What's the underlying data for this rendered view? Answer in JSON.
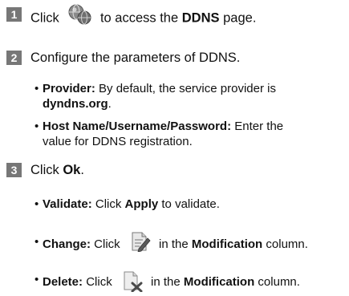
{
  "steps": [
    {
      "number": "1",
      "pre": "Click",
      "icon": "globe-network-icon",
      "post": "to access the",
      "bold": "DDNS",
      "tail": "page."
    },
    {
      "number": "2",
      "text": "Configure the parameters of DDNS.",
      "bullets": [
        {
          "label": "Provider:",
          "line1": "By default, the service provider is",
          "line2_bold": "dyndns.org",
          "line2_tail": "."
        },
        {
          "label": "Host Name/Username/Password:",
          "line1": "Enter the",
          "line2": "value for DDNS registration."
        }
      ]
    },
    {
      "number": "3",
      "pre": "Click",
      "bold": "Ok",
      "tail": ".",
      "bullets": [
        {
          "label": "Validate:",
          "pre": "Click",
          "bold": "Apply",
          "tail": "to validate."
        },
        {
          "label": "Change:",
          "pre": "Click",
          "icon": "edit-document-icon",
          "mid": "in the",
          "bold": "Modification",
          "tail": "column."
        },
        {
          "label": "Delete:",
          "pre": "Click",
          "icon": "delete-document-icon",
          "mid": "in the",
          "bold": "Modification",
          "tail": "column."
        }
      ]
    }
  ],
  "bullet_char": "•"
}
